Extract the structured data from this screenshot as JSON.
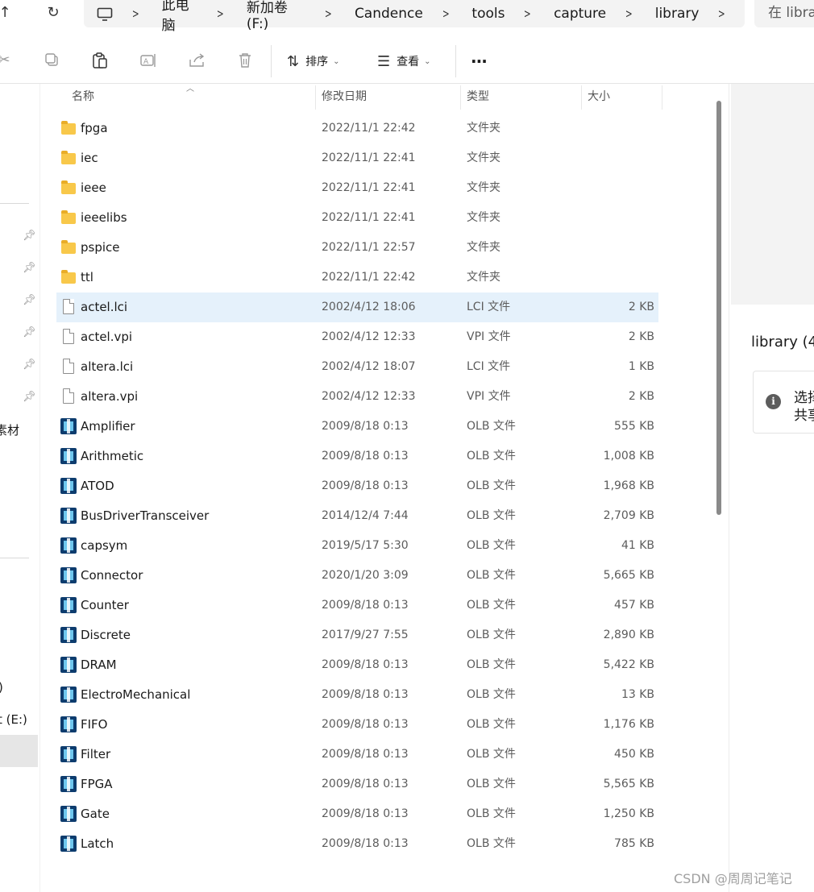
{
  "address_bar": {
    "breadcrumbs": [
      "此电脑",
      "新加卷 (F:)",
      "Candence",
      "tools",
      "capture",
      "library"
    ],
    "search_placeholder": "在 libra"
  },
  "toolbar": {
    "sort_label": "排序",
    "view_label": "查看",
    "more_label": "···"
  },
  "columns": {
    "name": "名称",
    "modified": "修改日期",
    "type": "类型",
    "size": "大小"
  },
  "left_nav": {
    "partial_labels": [
      "素材",
      ")",
      "t (E:)"
    ]
  },
  "files": [
    {
      "name": "fpga",
      "date": "2022/11/1 22:42",
      "type": "文件夹",
      "size": "",
      "icon": "folder"
    },
    {
      "name": "iec",
      "date": "2022/11/1 22:41",
      "type": "文件夹",
      "size": "",
      "icon": "folder"
    },
    {
      "name": "ieee",
      "date": "2022/11/1 22:41",
      "type": "文件夹",
      "size": "",
      "icon": "folder"
    },
    {
      "name": "ieeelibs",
      "date": "2022/11/1 22:41",
      "type": "文件夹",
      "size": "",
      "icon": "folder"
    },
    {
      "name": "pspice",
      "date": "2022/11/1 22:57",
      "type": "文件夹",
      "size": "",
      "icon": "folder"
    },
    {
      "name": "ttl",
      "date": "2022/11/1 22:42",
      "type": "文件夹",
      "size": "",
      "icon": "folder"
    },
    {
      "name": "actel.lci",
      "date": "2002/4/12 18:06",
      "type": "LCI 文件",
      "size": "2 KB",
      "icon": "file",
      "selected": true
    },
    {
      "name": "actel.vpi",
      "date": "2002/4/12 12:33",
      "type": "VPI 文件",
      "size": "2 KB",
      "icon": "file"
    },
    {
      "name": "altera.lci",
      "date": "2002/4/12 18:07",
      "type": "LCI 文件",
      "size": "1 KB",
      "icon": "file"
    },
    {
      "name": "altera.vpi",
      "date": "2002/4/12 12:33",
      "type": "VPI 文件",
      "size": "2 KB",
      "icon": "file"
    },
    {
      "name": "Amplifier",
      "date": "2009/8/18 0:13",
      "type": "OLB 文件",
      "size": "555 KB",
      "icon": "olb"
    },
    {
      "name": "Arithmetic",
      "date": "2009/8/18 0:13",
      "type": "OLB 文件",
      "size": "1,008 KB",
      "icon": "olb"
    },
    {
      "name": "ATOD",
      "date": "2009/8/18 0:13",
      "type": "OLB 文件",
      "size": "1,968 KB",
      "icon": "olb"
    },
    {
      "name": "BusDriverTransceiver",
      "date": "2014/12/4 7:44",
      "type": "OLB 文件",
      "size": "2,709 KB",
      "icon": "olb"
    },
    {
      "name": "capsym",
      "date": "2019/5/17 5:30",
      "type": "OLB 文件",
      "size": "41 KB",
      "icon": "olb"
    },
    {
      "name": "Connector",
      "date": "2020/1/20 3:09",
      "type": "OLB 文件",
      "size": "5,665 KB",
      "icon": "olb"
    },
    {
      "name": "Counter",
      "date": "2009/8/18 0:13",
      "type": "OLB 文件",
      "size": "457 KB",
      "icon": "olb"
    },
    {
      "name": "Discrete",
      "date": "2017/9/27 7:55",
      "type": "OLB 文件",
      "size": "2,890 KB",
      "icon": "olb"
    },
    {
      "name": "DRAM",
      "date": "2009/8/18 0:13",
      "type": "OLB 文件",
      "size": "5,422 KB",
      "icon": "olb"
    },
    {
      "name": "ElectroMechanical",
      "date": "2009/8/18 0:13",
      "type": "OLB 文件",
      "size": "13 KB",
      "icon": "olb"
    },
    {
      "name": "FIFO",
      "date": "2009/8/18 0:13",
      "type": "OLB 文件",
      "size": "1,176 KB",
      "icon": "olb"
    },
    {
      "name": "Filter",
      "date": "2009/8/18 0:13",
      "type": "OLB 文件",
      "size": "450 KB",
      "icon": "olb"
    },
    {
      "name": "FPGA",
      "date": "2009/8/18 0:13",
      "type": "OLB 文件",
      "size": "5,565 KB",
      "icon": "olb"
    },
    {
      "name": "Gate",
      "date": "2009/8/18 0:13",
      "type": "OLB 文件",
      "size": "1,250 KB",
      "icon": "olb"
    },
    {
      "name": "Latch",
      "date": "2009/8/18 0:13",
      "type": "OLB 文件",
      "size": "785 KB",
      "icon": "olb"
    }
  ],
  "details_pane": {
    "title": "library (4",
    "info_line1": "选择",
    "info_line2": "共享"
  },
  "watermark": "CSDN @周周记笔记"
}
